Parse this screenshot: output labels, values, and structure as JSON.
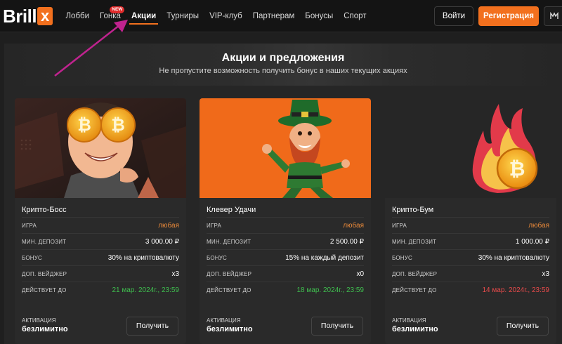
{
  "brand": {
    "logo_text": "Brill",
    "logo_x": "x"
  },
  "nav": {
    "items": [
      {
        "label": "Лобби"
      },
      {
        "label": "Гонка",
        "badge": "NEW"
      },
      {
        "label": "Акции",
        "active": true
      },
      {
        "label": "Турниры"
      },
      {
        "label": "VIP-клуб"
      },
      {
        "label": "Партнерам"
      },
      {
        "label": "Бонусы"
      },
      {
        "label": "Спорт"
      }
    ]
  },
  "header": {
    "login_label": "Войти",
    "register_label": "Регистрация",
    "lang_icon": "language-icon"
  },
  "colors": {
    "accent": "#f2701e",
    "green": "#3fbf4f",
    "red": "#e94b4b",
    "orange_text": "#e8893a",
    "annotation_arrow": "#c0238f"
  },
  "banner": {
    "title": "Акции и предложения",
    "subtitle": "Не пропустите возможность получить бонус в наших текущих акциях"
  },
  "cards": [
    {
      "title": "Крипто-Босс",
      "image": "crypto-boss-illustration",
      "rows": [
        {
          "label": "Игра",
          "value": "любая"
        },
        {
          "label": "Мин. депозит",
          "value": "3 000.00 ₽"
        },
        {
          "label": "Бонус",
          "value": "30% на криптовалюту"
        },
        {
          "label": "Доп. вейджер",
          "value": "x3"
        },
        {
          "label": "Действует до",
          "value": "21 мар. 2024г., 23:59"
        }
      ],
      "activation_label": "Активация",
      "activation_value": "безлимитно",
      "button_label": "Получить"
    },
    {
      "title": "Клевер Удачи",
      "image": "leprechaun-illustration",
      "rows": [
        {
          "label": "Игра",
          "value": "любая"
        },
        {
          "label": "Мин. депозит",
          "value": "2 500.00 ₽"
        },
        {
          "label": "Бонус",
          "value": "15% на каждый депозит"
        },
        {
          "label": "Доп. вейджер",
          "value": "x0"
        },
        {
          "label": "Действует до",
          "value": "18 мар. 2024г., 23:59"
        }
      ],
      "activation_label": "Активация",
      "activation_value": "безлимитно",
      "button_label": "Получить"
    },
    {
      "title": "Крипто-Бум",
      "image": "flaming-bitcoin-illustration",
      "rows": [
        {
          "label": "Игра",
          "value": "любая"
        },
        {
          "label": "Мин. депозит",
          "value": "1 000.00 ₽"
        },
        {
          "label": "Бонус",
          "value": "30% на криптовалюту"
        },
        {
          "label": "Доп. вейджер",
          "value": "x3"
        },
        {
          "label": "Действует до",
          "value": "14 мар. 2024г., 23:59"
        }
      ],
      "activation_label": "Активация",
      "activation_value": "безлимитно",
      "button_label": "Получить"
    }
  ]
}
